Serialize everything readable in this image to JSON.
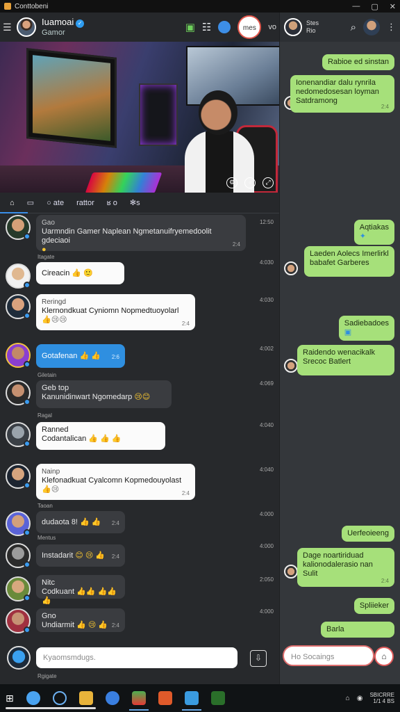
{
  "os": {
    "title": "Conttobeni"
  },
  "header": {
    "name": "Iuamoai",
    "sub": "Gamor",
    "live": "mes",
    "mini": "vo"
  },
  "tabs": [
    {
      "label": ""
    },
    {
      "label": ""
    },
    {
      "label": "ate"
    },
    {
      "label": "rattor"
    },
    {
      "label": "o"
    },
    {
      "label": "s"
    }
  ],
  "messages": [
    {
      "name": "Gao",
      "text": "Uarmndin Gamer Naplean Ngmetanuifryemedoolit gdeciaoi",
      "time": "2:4",
      "stamp": "12:50",
      "style": "dark"
    },
    {
      "above": "Itagate",
      "text": "Cireacin",
      "emoji": "👍 🙂",
      "time": "",
      "stamp": "4:030",
      "style": "white"
    },
    {
      "name": "Reringd",
      "text": "Klernondkuat Cyniomn Nopmedtuoyolarl",
      "emoji": "👍😢😢",
      "time": "2:4",
      "stamp": "4:030",
      "style": "white"
    },
    {
      "text": "Gotafenan",
      "emoji": "👍 👍",
      "time": "2:6",
      "stamp": "4:002",
      "style": "blue"
    },
    {
      "above": "Giletain",
      "name": "Geb top",
      "text": "Kanunidinwart Ngomedarp",
      "emoji": "😢😊",
      "time": "",
      "stamp": "4:069",
      "style": "dark"
    },
    {
      "above": "Ragal",
      "name": "Ranned",
      "text": "Codantalican",
      "emoji": "👍 👍 👍",
      "time": "",
      "stamp": "4:040",
      "style": "white"
    },
    {
      "name": "Nainp",
      "text": "Klefonadkuat Cyalcomn Kopmedouyolast",
      "emoji": "👍😢",
      "time": "2:4",
      "stamp": "4:040",
      "style": "white"
    },
    {
      "above": "Taoan",
      "text": "dudaota 8!",
      "emoji": "👍 👍",
      "time": "2:4",
      "stamp": "4:000",
      "style": "dark"
    },
    {
      "above": "Mentus",
      "text": "Instadarit",
      "emoji": "😊 😢 👍",
      "time": "2:4",
      "stamp": "4:000",
      "style": "dark"
    },
    {
      "name": "Nitc",
      "text": "Codkuant",
      "emoji": "👍👍 👍👍 👍",
      "time": "",
      "stamp": "2:050",
      "style": "dark"
    },
    {
      "name": "Gno",
      "text": "Undiarmit",
      "emoji": "👍 😢 👍",
      "time": "2:4",
      "stamp": "4:000",
      "style": "dark"
    }
  ],
  "composer": {
    "placeholder": "Kyaomsmdugs.",
    "hint": "Rgigate"
  },
  "right": {
    "title": "Stes",
    "subtitle": "Rio",
    "messages": [
      {
        "text": "Rabioe ed sinstan",
        "time": ""
      },
      {
        "text": "Ionenandiar dalu rynrila nedomedosesan loyman Satdramong",
        "time": "2:4"
      },
      {
        "text": "Aqtiakas",
        "time": ""
      },
      {
        "text": "Laeden Aolecs Imerlirkl babafet Garberes",
        "time": ""
      },
      {
        "text": "Sadiebadoes",
        "time": ""
      },
      {
        "text": "Raidendo wenacikalk Srecoc Batlert",
        "time": ""
      },
      {
        "text": "Uerfeoieeng",
        "time": ""
      },
      {
        "text": "Dage noartiriduad kalionodalerasio nan Sulit",
        "time": "2:4"
      },
      {
        "text": "Spliieker",
        "time": ""
      },
      {
        "text": "Barla",
        "time": ""
      }
    ],
    "composer": {
      "placeholder": "Socaings",
      "prefix": "Ho"
    }
  },
  "taskbar": {
    "clock_line1": "SBICRRE",
    "clock_line2": "1/1 4 BS"
  },
  "colors": {
    "accent": "#2f8fe0",
    "green_bubble": "#a6e07a",
    "live_ring": "#e2574c"
  }
}
